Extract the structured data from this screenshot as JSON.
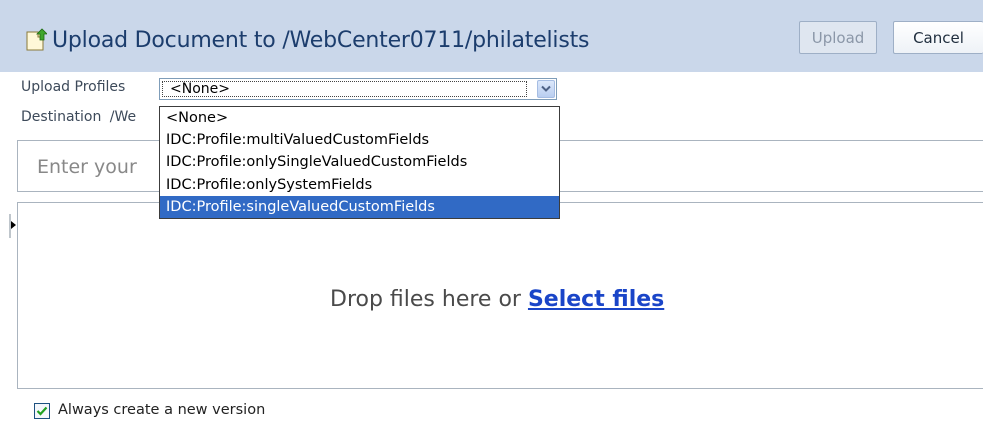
{
  "dialog": {
    "title": "Upload Document to /WebCenter0711/philatelists",
    "upload_label": "Upload",
    "cancel_label": "Cancel"
  },
  "form": {
    "profiles_label": "Upload Profiles",
    "profiles_value": "<None>",
    "destination_label": "Destination",
    "destination_value": "/We",
    "title_placeholder": "Enter your",
    "dropdown_options": [
      "<None>",
      "IDC:Profile:multiValuedCustomFields",
      "IDC:Profile:onlySingleValuedCustomFields",
      "IDC:Profile:onlySystemFields",
      "IDC:Profile:singleValuedCustomFields"
    ],
    "highlighted_option_index": 4
  },
  "drop_zone": {
    "text": "Drop files here or ",
    "link": "Select files"
  },
  "options": {
    "always_new_version_label": "Always create a new version",
    "always_new_version_checked": true
  },
  "colors": {
    "header_bg": "#cad7ea",
    "title_text": "#1c3d6d",
    "selection": "#316ac5",
    "link": "#1a45c8"
  },
  "icons": {
    "title": "upload-document-icon",
    "select": "chevron-down-icon",
    "splitter": "collapse-arrow-icon",
    "checkbox": "checkmark-icon"
  }
}
